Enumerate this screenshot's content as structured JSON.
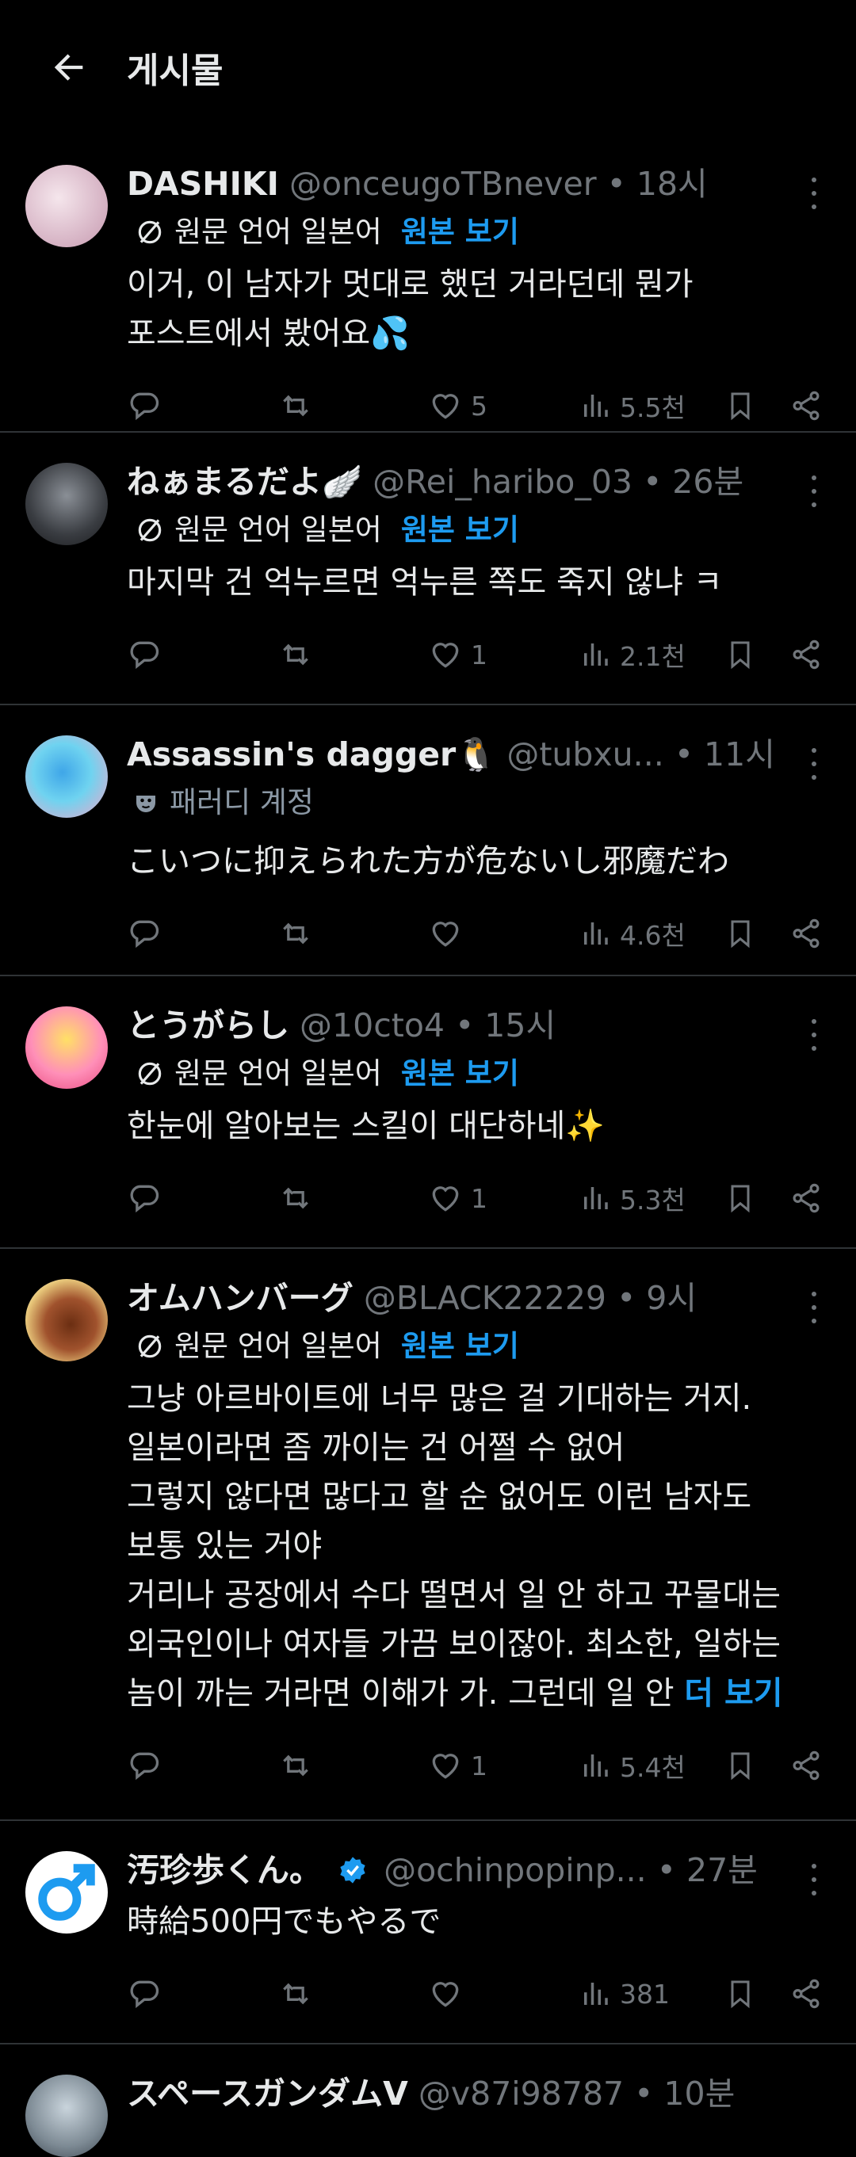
{
  "header": {
    "title": "게시물"
  },
  "translation": {
    "label": "원문 언어 일본어",
    "show_original": "원본 보기"
  },
  "posts": [
    {
      "name": "DASHIKI",
      "handle": "@onceugoTBnever",
      "sep": "•",
      "time": "18시",
      "text": "이거, 이 남자가 멋대로 했던 거라던데 뭔가\n포스트에서 봤어요💦",
      "likes": "5",
      "views": "5.5천"
    },
    {
      "name": "ねぁまるだよ🪽",
      "handle": "@Rei_haribo_03",
      "sep": "•",
      "time": "26분",
      "text": "마지막 건 억누르면 억누른 쪽도 죽지 않냐 ㅋ",
      "likes": "1",
      "views": "2.1천"
    },
    {
      "name": "Assassin's dagger🐧",
      "handle": "@tubxu...",
      "sep": "•",
      "time": "11시",
      "badge": "패러디 계정",
      "text": "こいつに抑えられた方が危ないし邪魔だわ",
      "likes": "",
      "views": "4.6천"
    },
    {
      "name": "とうがらし",
      "handle": "@10cto4",
      "sep": "•",
      "time": "15시",
      "text": "한눈에 알아보는 스킬이 대단하네✨",
      "likes": "1",
      "views": "5.3천"
    },
    {
      "name": "オムハンバーグ",
      "handle": "@BLACK22229",
      "sep": "•",
      "time": "9시",
      "text": "그냥 아르바이트에 너무 많은 걸 기대하는 거지.\n일본이라면 좀 까이는 건 어쩔 수 없어\n그렇지 않다면 많다고 할 순 없어도 이런 남자도\n보통 있는 거야\n거리나 공장에서 수다 떨면서 일 안 하고 꾸물대는\n외국인이나 여자들 가끔 보이잖아. 최소한, 일하는\n놈이 까는 거라면 이해가 가. 그런데 일 안 ",
      "more": "더 보기",
      "likes": "1",
      "views": "5.4천"
    },
    {
      "name": "汚珍歩くん。",
      "handle": "@ochinpopinp...",
      "sep": "•",
      "time": "27분",
      "text": "時給500円でもやるで",
      "likes": "",
      "views": "381"
    },
    {
      "name": "スペースガンダムV",
      "handle": "@v87i98787",
      "sep": "•",
      "time": "10분"
    }
  ],
  "colors": {
    "accent": "#1d9bf0",
    "muted": "#71767b",
    "divider": "#2f3336"
  }
}
